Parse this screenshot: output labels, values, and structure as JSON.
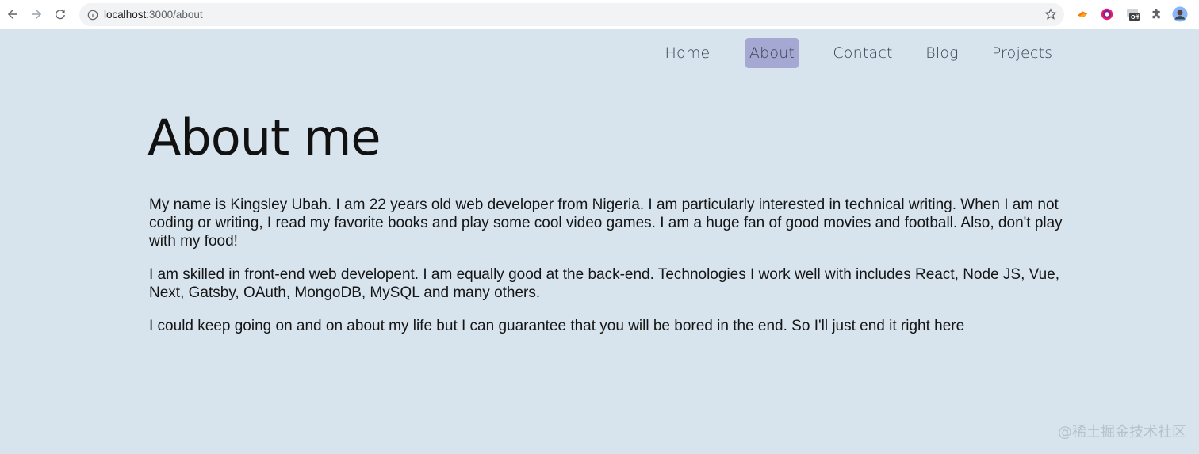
{
  "browser": {
    "url_host": "localhost",
    "url_path": ":3000/about",
    "extension_off_badge": "Off"
  },
  "nav": {
    "items": [
      {
        "label": "Home"
      },
      {
        "label": "About"
      },
      {
        "label": "Contact"
      },
      {
        "label": "Blog"
      },
      {
        "label": "Projects"
      }
    ],
    "active": "About",
    "active_color": "#a4a8d2"
  },
  "main": {
    "title": "About me",
    "paragraphs": [
      "My name is Kingsley Ubah. I am 22 years old web developer from Nigeria. I am particularly interested in technical writing. When I am not coding or writing, I read my favorite books and play some cool video games. I am a huge fan of good movies and football. Also, don't play with my food!",
      "I am skilled in front-end web developent. I am equally good at the back-end. Technologies I work well with includes React, Node JS, Vue, Next, Gatsby, OAuth, MongoDB, MySQL and many others.",
      "I could keep going on and on about my life but I can guarantee that you will be bored in the end. So I'll just end it right here"
    ]
  },
  "watermark": "@稀土掘金技术社区",
  "colors": {
    "page_background": "#d7e4ee",
    "text": "#151515"
  }
}
